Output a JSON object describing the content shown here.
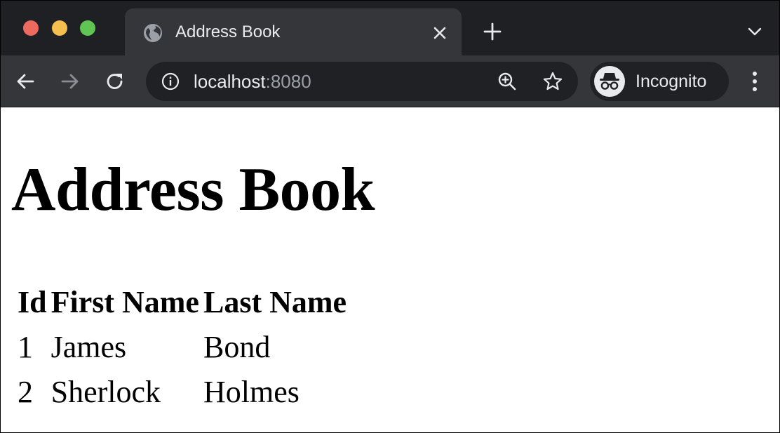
{
  "browser": {
    "tab": {
      "title": "Address Book",
      "favicon": "globe-icon"
    },
    "omnibox": {
      "host": "localhost",
      "port": ":8080"
    },
    "profile": {
      "label": "Incognito",
      "icon": "incognito-icon"
    },
    "colors": {
      "tabstrip": "#1f2023",
      "toolbar": "#35363a",
      "omnibox": "#202124",
      "text": "#e8eaed",
      "muted": "#9aa0a6",
      "traffic_red": "#ee6a5e",
      "traffic_yellow": "#f5bf4f",
      "traffic_green": "#61c554"
    }
  },
  "page": {
    "title": "Address Book",
    "table": {
      "headers": [
        "Id",
        "First Name",
        "Last Name"
      ],
      "rows": [
        [
          "1",
          "James",
          "Bond"
        ],
        [
          "2",
          "Sherlock",
          "Holmes"
        ]
      ]
    }
  }
}
